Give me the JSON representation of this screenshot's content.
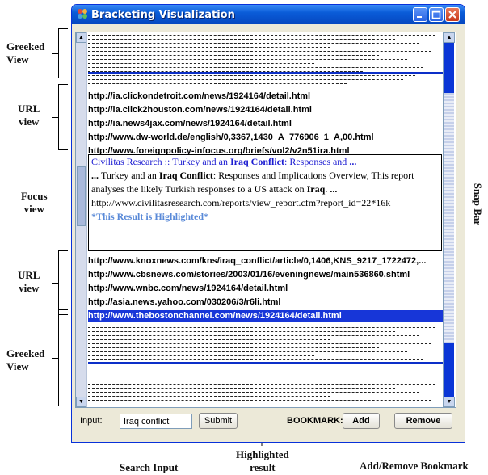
{
  "window": {
    "title": "Bracketing Visualization"
  },
  "annotations": {
    "greeked_view_top": "Greeked\nView",
    "url_view_top": "URL\nview",
    "focus_view": "Focus\nview",
    "url_view_bottom": "URL\nview",
    "greeked_view_bottom": "Greeked\nView",
    "snap_bar": "Snap Bar",
    "search_input": "Search Input",
    "highlighted_result": "Highlighted\nresult",
    "add_remove_bookmark": "Add/Remove Bookmark"
  },
  "urls_top": [
    "http://ia.clickondetroit.com/news/1924164/detail.html",
    "http://ia.click2houston.com/news/1924164/detail.html",
    "http://ia.news4jax.com/news/1924164/detail.html",
    "http://www.dw-world.de/english/0,3367,1430_A_776906_1_A,00.html",
    "http://www.foreignpolicy-infocus.org/briefs/vol2/v2n51ira.html"
  ],
  "focus": {
    "title_prefix": "Civilitas Research :: Turkey and an ",
    "title_bold": "Iraq Conflict",
    "title_suffix": ": Responses and ",
    "title_ellipsis": "...",
    "snippet_start": "... ",
    "snippet_1": "Turkey and an ",
    "snippet_bold_1": "Iraq Conflict",
    "snippet_2": ": Responses and Implications Overview, This report analyses the likely Turkish responses to a US attack on ",
    "snippet_bold_2": "Iraq",
    "snippet_3": ". ",
    "snippet_end": "...",
    "url_line": "http://www.civilitasresearch.com/reports/view_report.cfm?report_id=22*16k",
    "highlight_note": "*This Result is Highlighted*"
  },
  "urls_bottom": [
    "http://www.knoxnews.com/kns/iraq_conflict/article/0,1406,KNS_9217_1722472,...",
    "http://www.cbsnews.com/stories/2003/01/16/eveningnews/main536860.shtml",
    "http://www.wnbc.com/news/1924164/detail.html",
    "http://asia.news.yahoo.com/030206/3/r6li.html",
    "http://www.thebostonchannel.com/news/1924164/detail.html"
  ],
  "bottom_bar": {
    "input_label": "Input:",
    "input_value": "Iraq conflict",
    "submit_label": "Submit",
    "bookmark_label": "BOOKMARK:",
    "add_label": "Add",
    "remove_label": "Remove"
  },
  "colors": {
    "highlight": "#1736d8",
    "snap_bar_mark": "#0a36d6",
    "title_bar": "#0a5cd8"
  },
  "icons": [
    "app-icon",
    "minimize-icon",
    "maximize-icon",
    "close-icon",
    "scroll-up-icon",
    "scroll-down-icon"
  ]
}
